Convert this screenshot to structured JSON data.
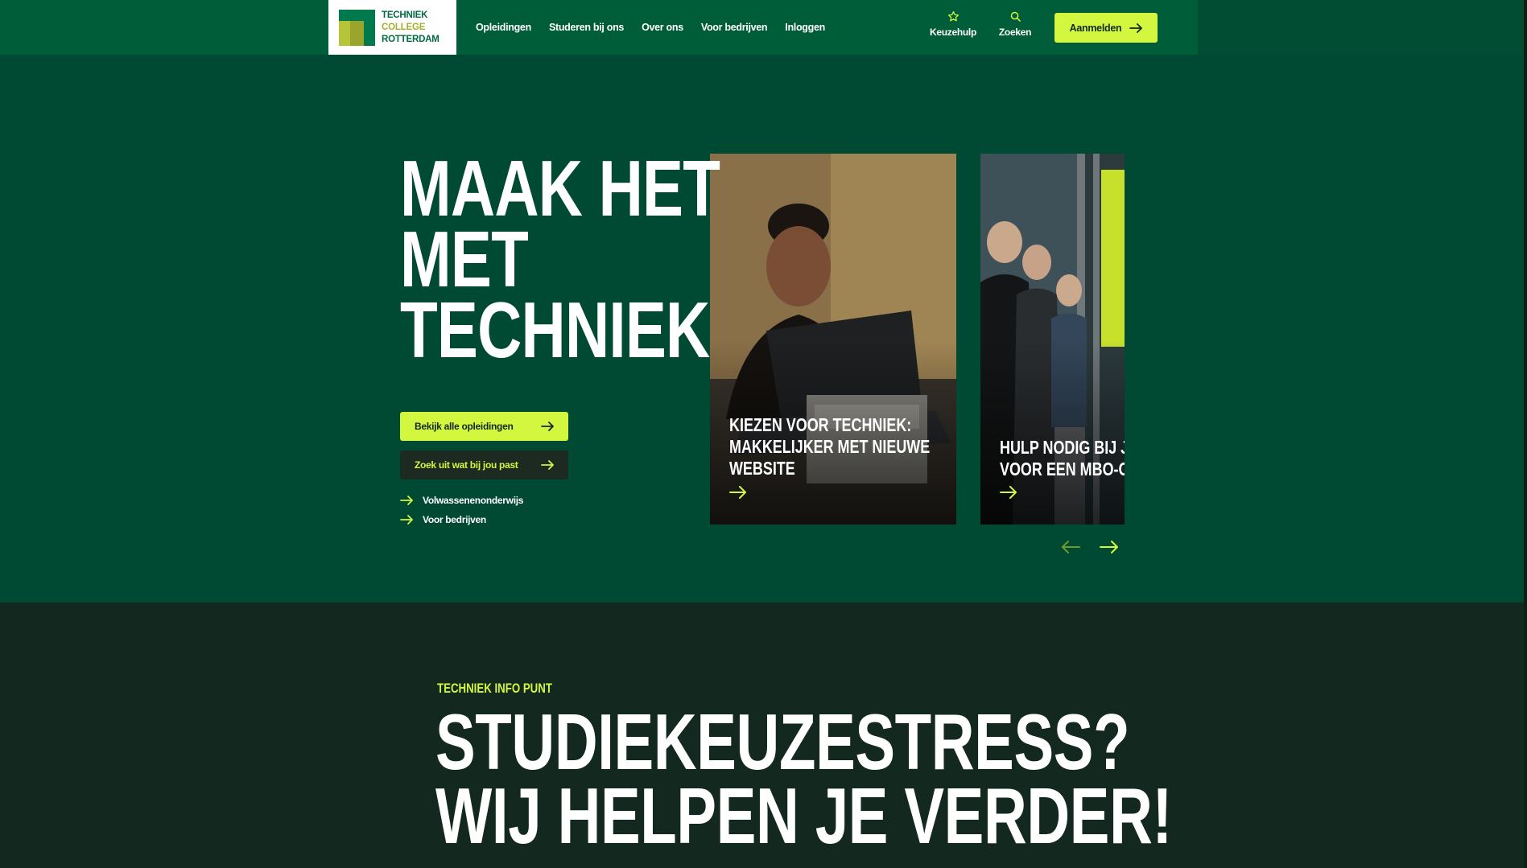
{
  "header": {
    "logo": {
      "line1": "TECHNIEK",
      "line2": "COLLEGE",
      "line3": "ROTTERDAM"
    },
    "nav": [
      {
        "label": "Opleidingen"
      },
      {
        "label": "Studeren bij ons"
      },
      {
        "label": "Over ons"
      },
      {
        "label": "Voor bedrijven"
      },
      {
        "label": "Inloggen"
      }
    ],
    "keuzehulp_label": "Keuzehulp",
    "zoeken_label": "Zoeken",
    "cta_label": "Aanmelden"
  },
  "hero": {
    "title_line1": "MAAK HET MET",
    "title_line2": "TECHNIEK",
    "primary_button": "Bekijk alle opleidingen",
    "secondary_button": "Zoek uit wat bij jou past",
    "links": [
      "Volwassenenonderwijs",
      "Voor bedrijven"
    ],
    "cards": [
      {
        "title_lines": [
          "KIEZEN VOOR TECHNIEK:",
          "MAKKELIJKER MET NIEUWE",
          "WEBSITE"
        ]
      },
      {
        "title_lines": [
          "HULP NODIG BIJ JE",
          "VOOR EEN MBO-OP"
        ]
      }
    ]
  },
  "info": {
    "eyebrow": "TECHNIEK INFO PUNT",
    "title_line1": "STUDIEKEUZESTRESS?",
    "title_line2": "WIJ HELPEN JE VERDER!"
  },
  "colors": {
    "header_green": "#005d3a",
    "hero_green": "#004a34",
    "dark": "#13291f",
    "accent_lime": "#d3f63f"
  }
}
